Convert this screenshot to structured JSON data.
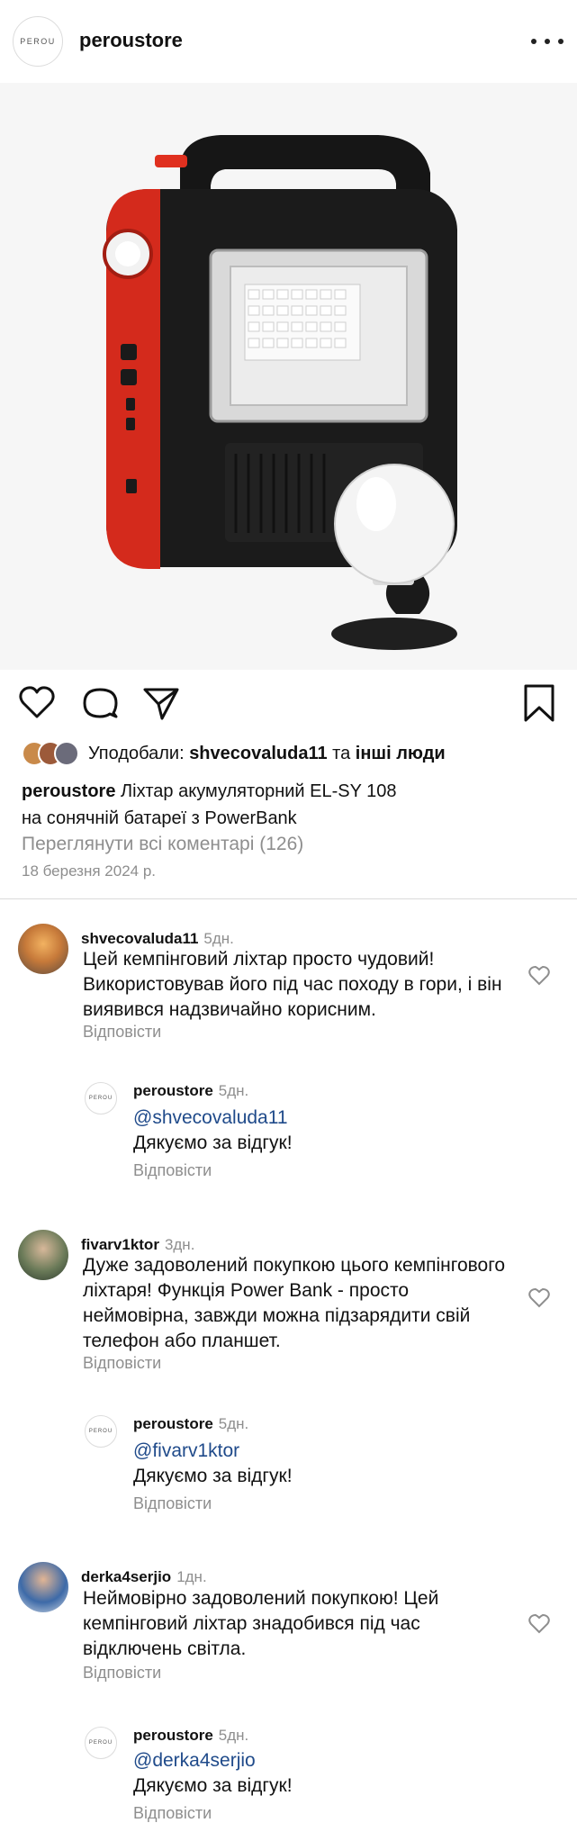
{
  "header": {
    "logo_text": "PEROU",
    "username": "peroustore",
    "more_icon": "more-horizontal-icon"
  },
  "photo": {
    "subject": "product-photo"
  },
  "actions": {
    "like_icon": "heart-icon",
    "comment_icon": "comment-icon",
    "share_icon": "send-icon",
    "save_icon": "bookmark-icon"
  },
  "likes": {
    "prefix": "Уподобали: ",
    "first_user": "shvecovaluda11",
    "joiner": " та ",
    "others": "інші люди"
  },
  "caption": {
    "username": "peroustore",
    "text_line1": " Ліхтар акумуляторний EL-SY 108",
    "text_line2": "на сонячній батареї з PowerBank"
  },
  "view_all_comments": "Переглянути всі коментарі (126)",
  "post_date": "18 березня 2024 р.",
  "comments": [
    {
      "username": "shvecovaluda11",
      "time": "5дн.",
      "text": "Цей кемпінговий ліхтар просто чудовий! Використовував його під час походу в гори, і він виявився надзвичайно корисним.",
      "reply_label": "Відповісти",
      "reply": {
        "username": "peroustore",
        "time": "5дн.",
        "mention": "@shvecovaluda11",
        "text": "Дякуємо за відгук!",
        "reply_label": "Відповісти"
      }
    },
    {
      "username": "fivarv1ktor",
      "time": "3дн.",
      "text": "Дуже задоволений покупкою цього кемпінгового ліхтаря! Функція Power Bank - просто неймовірна, завжди можна підзарядити свій телефон або планшет.",
      "reply_label": "Відповісти",
      "reply": {
        "username": "peroustore",
        "time": "5дн.",
        "mention": "@fivarv1ktor",
        "text": "Дякуємо за відгук!",
        "reply_label": "Відповісти"
      }
    },
    {
      "username": "derka4serjio",
      "time": "1дн.",
      "text": "Неймовірно задоволений покупкою! Цей кемпінговий ліхтар знадобився під час відключень світла.",
      "reply_label": "Відповісти",
      "reply": {
        "username": "peroustore",
        "time": "5дн.",
        "mention": "@derka4serjio",
        "text": "Дякуємо за відгук!",
        "reply_label": "Відповісти"
      }
    }
  ],
  "colors": {
    "muted": "#8e8e8e",
    "mention": "#1f4a8a",
    "lamp_red": "#d42a1c",
    "lamp_body": "#1a1a1a"
  }
}
